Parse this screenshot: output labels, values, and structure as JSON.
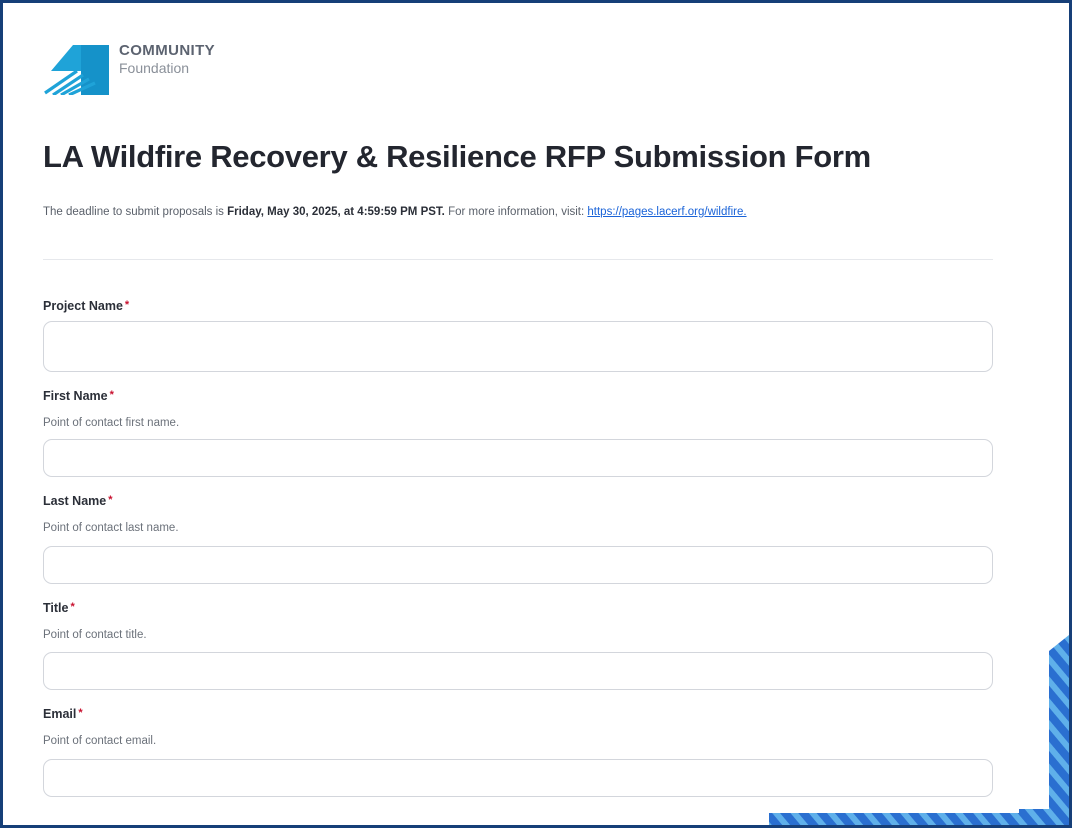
{
  "logo": {
    "name": "community-foundation-logo",
    "line1": "COMMUNITY",
    "line2": "Foundation",
    "color": "#1fa3d8"
  },
  "form": {
    "title": "LA Wildfire Recovery & Resilience RFP Submission Form",
    "intro_prefix": "The deadline to submit proposals is ",
    "intro_deadline": "Friday, May 30, 2025, at 4:59:59 PM PST.",
    "intro_middle": " For more information, visit: ",
    "intro_link": "https://pages.lacerf.org/wildfire.",
    "required_marker": "*",
    "fields": [
      {
        "label": "Project Name",
        "help": "",
        "value": ""
      },
      {
        "label": "First Name",
        "help": "Point of contact first name.",
        "value": ""
      },
      {
        "label": "Last Name",
        "help": "Point of contact last name.",
        "value": ""
      },
      {
        "label": "Title",
        "help": "Point of contact title.",
        "value": ""
      },
      {
        "label": "Email",
        "help": "Point of contact email.",
        "value": ""
      }
    ]
  },
  "colors": {
    "frame": "#163f78",
    "accent_blue": "#1a63d8",
    "required": "#c8102e",
    "decoration": "#1f66c9"
  }
}
